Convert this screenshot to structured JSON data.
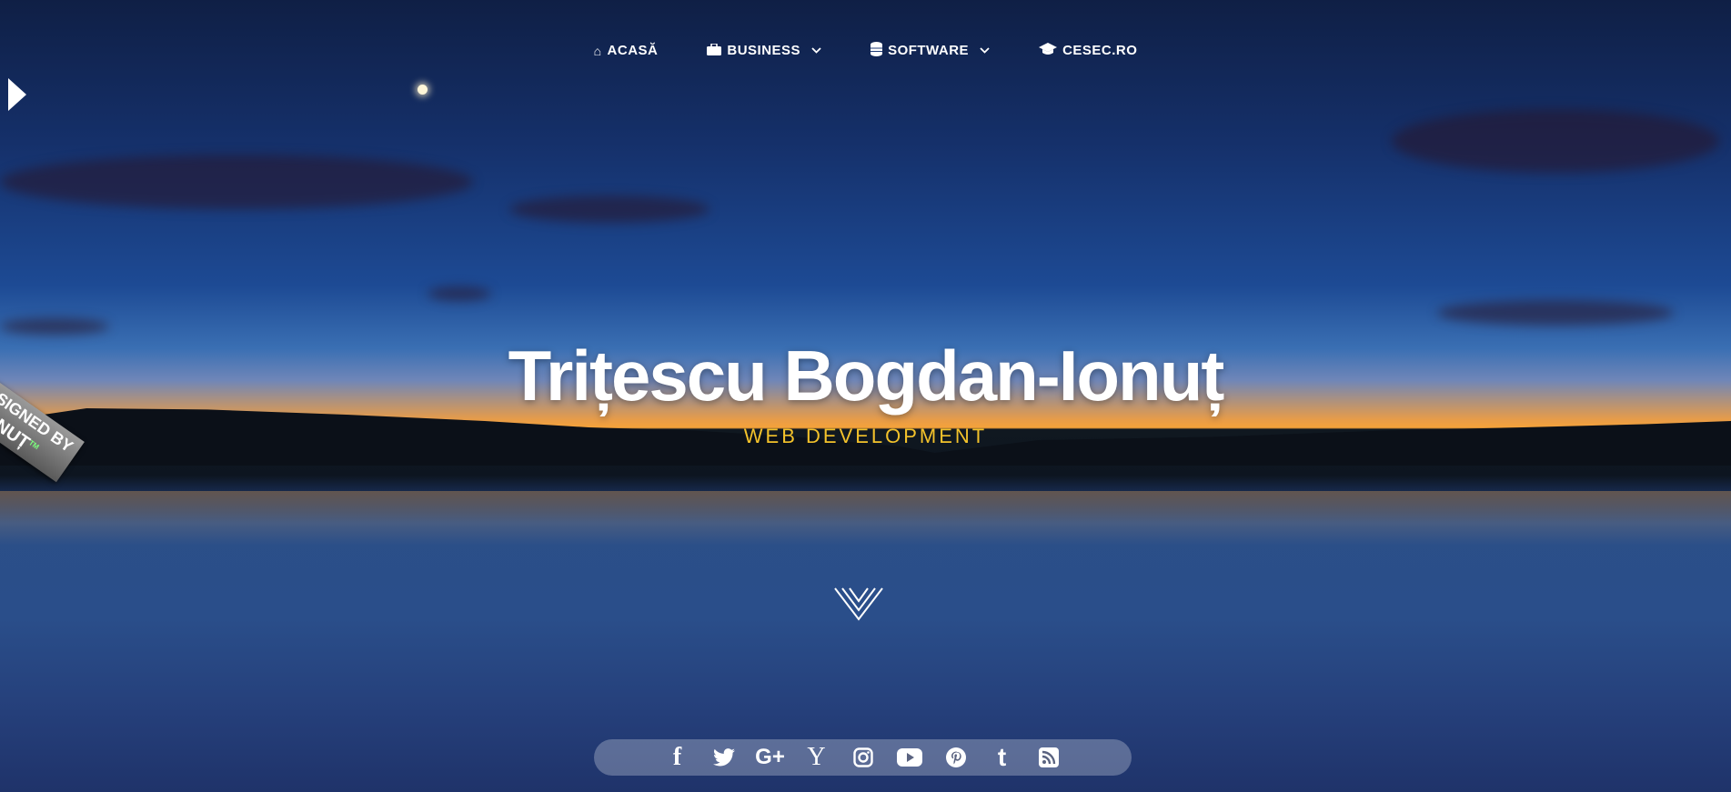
{
  "nav": {
    "items": [
      {
        "label": "ACASĂ",
        "icon": "home-icon",
        "has_dropdown": false
      },
      {
        "label": "BUSINESS",
        "icon": "briefcase-icon",
        "has_dropdown": true
      },
      {
        "label": "SOFTWARE",
        "icon": "database-icon",
        "has_dropdown": true
      },
      {
        "label": "CESEC.RO",
        "icon": "graduation-cap-icon",
        "has_dropdown": false
      }
    ]
  },
  "badge": {
    "line1": "DESIGNED BY",
    "line2": "© IONUȚ",
    "tm": "TM"
  },
  "hero": {
    "title": "Trițescu Bogdan-Ionuț",
    "subtitle": "WEB DEVELOPMENT"
  },
  "social": [
    {
      "name": "facebook-icon",
      "glyph": "f"
    },
    {
      "name": "twitter-icon",
      "glyph": ""
    },
    {
      "name": "google-plus-icon",
      "glyph": "G+"
    },
    {
      "name": "yahoo-icon",
      "glyph": "Y"
    },
    {
      "name": "instagram-icon",
      "glyph": ""
    },
    {
      "name": "youtube-icon",
      "glyph": ""
    },
    {
      "name": "pinterest-icon",
      "glyph": ""
    },
    {
      "name": "tumblr-icon",
      "glyph": "t"
    },
    {
      "name": "rss-icon",
      "glyph": ""
    }
  ],
  "colors": {
    "accent": "#f3c22b",
    "text": "#ffffff"
  }
}
